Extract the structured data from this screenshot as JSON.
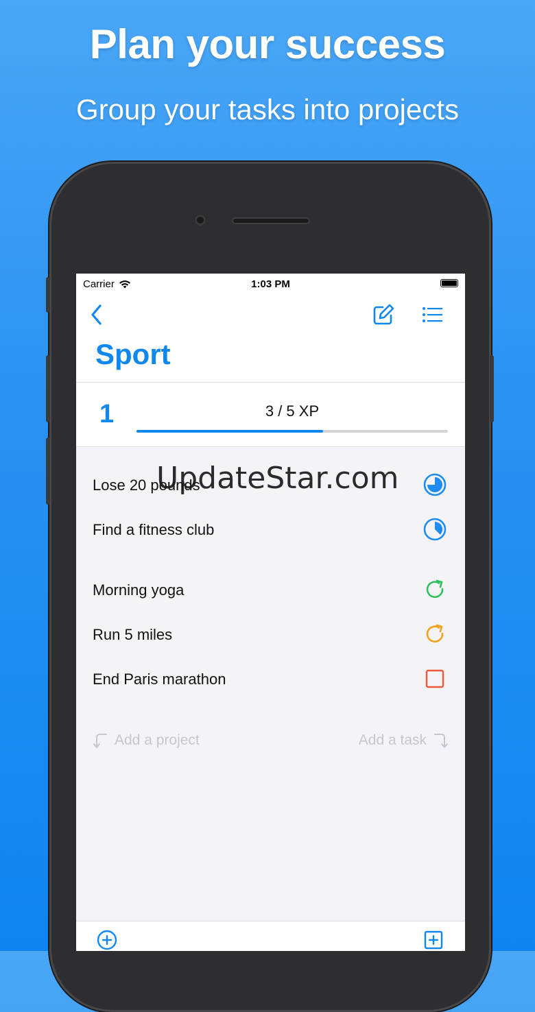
{
  "promo": {
    "headline": "Plan your success",
    "subline": "Group your tasks into projects"
  },
  "status_bar": {
    "carrier": "Carrier",
    "time": "1:03 PM"
  },
  "nav": {
    "back_icon": "chevron-left-icon",
    "edit_icon": "edit-icon",
    "list_icon": "list-icon"
  },
  "project": {
    "title": "Sport",
    "level": "1",
    "xp_text": "3 / 5 XP",
    "xp_progress": 0.6
  },
  "items": [
    {
      "label": "Lose 20 pounds",
      "icon": "pie-progress-icon",
      "color": "#1e8cf0"
    },
    {
      "label": "Find a fitness club",
      "icon": "pie-progress-small-icon",
      "color": "#1e8cf0"
    },
    {
      "label": "Morning yoga",
      "icon": "repeat-icon",
      "color": "#2fc15a"
    },
    {
      "label": "Run 5 miles",
      "icon": "repeat-icon",
      "color": "#f3a11c"
    },
    {
      "label": "End Paris marathon",
      "icon": "checkbox-icon",
      "color": "#ec5a3c"
    }
  ],
  "hints": {
    "add_project": "Add a project",
    "add_task": "Add a task"
  },
  "watermark": "UpdateStar.com",
  "colors": {
    "accent": "#1087ec",
    "hint": "#c6c6cc"
  }
}
